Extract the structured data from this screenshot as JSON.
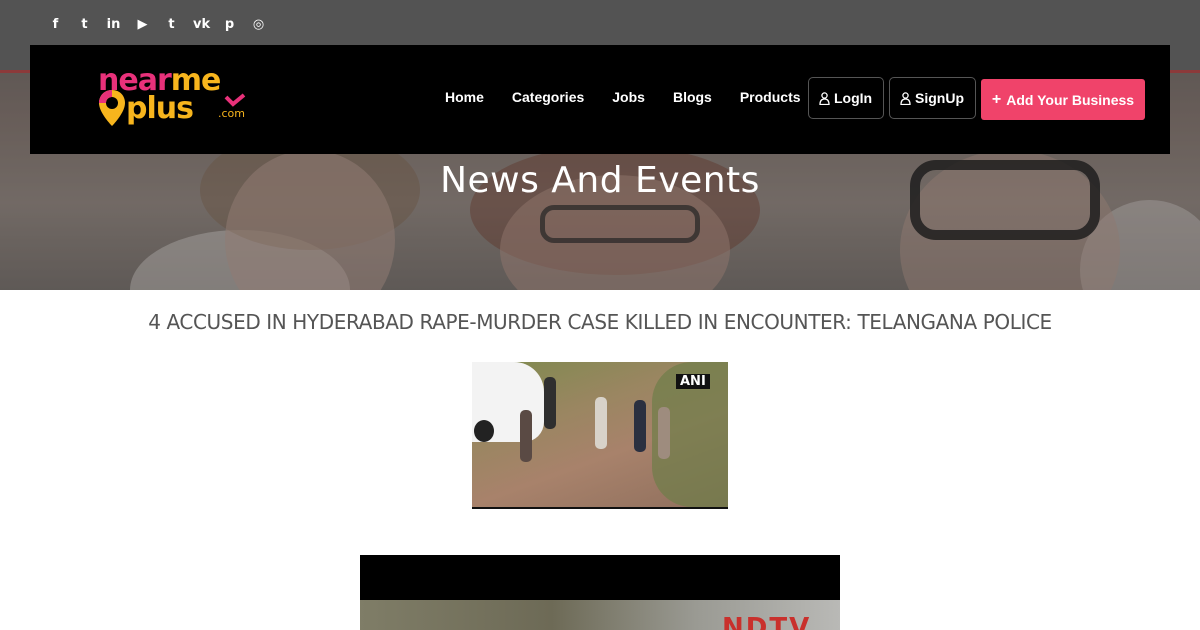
{
  "topbar": {
    "social_icons": [
      "facebook-icon",
      "twitter-icon",
      "linkedin-icon",
      "youtube-icon",
      "tumblr-icon",
      "vk-icon",
      "pinterest-icon",
      "instagram-icon"
    ],
    "social_glyphs": [
      "f",
      "t",
      "in",
      "▶",
      "t",
      "vk",
      "p",
      "◎"
    ]
  },
  "brand": {
    "logo_near": "near",
    "logo_me": "me",
    "logo_plus": "plus",
    "logo_com": ".com",
    "pink": "#e8317a",
    "yellow": "#f7b51d"
  },
  "nav": {
    "items": [
      "Home",
      "Categories",
      "Jobs",
      "Blogs",
      "Products"
    ],
    "login_label": "LogIn",
    "signup_label": "SignUp",
    "add_business_label": "Add Your Business",
    "add_business_color": "#f0436a"
  },
  "hero": {
    "title": "News And Events"
  },
  "article": {
    "title": "4 ACCUSED IN HYDERABAD RAPE-MURDER CASE KILLED IN ENCOUNTER: TELANGANA POLICE",
    "image1_watermark": "ANI",
    "image2_watermark": "NDTV"
  }
}
